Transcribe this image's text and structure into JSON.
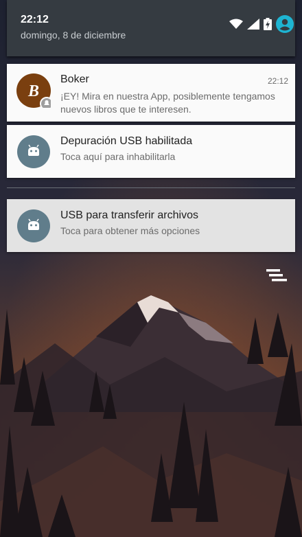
{
  "status": {
    "time": "22:12",
    "date": "domingo, 8 de diciembre",
    "icons": [
      "wifi-icon",
      "signal-icon",
      "battery-charging-icon",
      "account-icon"
    ]
  },
  "notifications": [
    {
      "app": "Boker",
      "time": "22:12",
      "text": "¡EY! Mira en nuestra App, posiblemente tengamos nuevos libros que te interesen.",
      "icon": "boker-logo-icon",
      "logo_letter": "B"
    },
    {
      "title": "Depuración USB habilitada",
      "text": "Toca aquí para inhabilitarla",
      "icon": "android-icon"
    },
    {
      "title": "USB para transferir archivos",
      "text": "Toca para obtener más opciones",
      "icon": "android-icon"
    }
  ],
  "actions": {
    "clear_all_icon": "clear-all-icon"
  },
  "colors": {
    "header_bg": "#353b41",
    "card_bg": "#fafafa",
    "boker_brand": "#7a3f0f",
    "android_badge": "#607d8b",
    "account_accent": "#1eb4d2"
  }
}
